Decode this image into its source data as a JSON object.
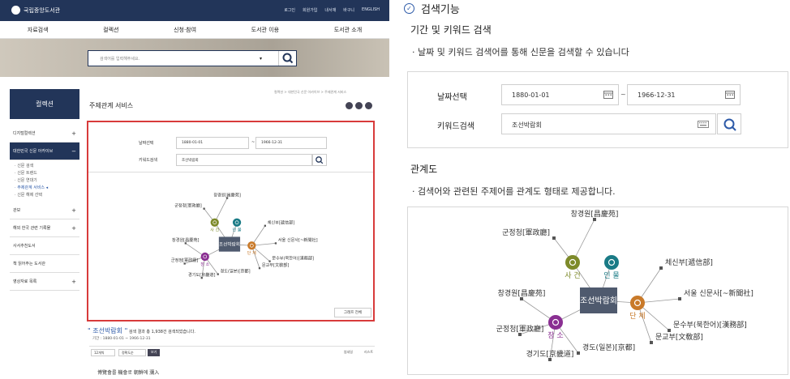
{
  "site": {
    "logo_text": "국립중앙도서관",
    "utils": [
      "로그인",
      "회원가입",
      "내서재",
      "바구니",
      "ENGLISH"
    ],
    "nav": [
      "자료검색",
      "컬렉션",
      "신청·참여",
      "도서관 이용",
      "도서관 소개"
    ],
    "search_placeholder": "검색어를 입력해주세요."
  },
  "sidebar": {
    "title": "컬렉션",
    "items": [
      "디지털컬렉션",
      "대한민국 신문 아카이브",
      "관보",
      "해외 한국 관련 기록물",
      "사서추천도서",
      "책 읽어주는 도서관",
      "영상자료 목록"
    ],
    "subitems": [
      "신문 검색",
      "신문 트렌드",
      "신문 연대기",
      "주제관계 서비스",
      "신문 해제 선택"
    ],
    "active_sub": "주제관계 서비스"
  },
  "content": {
    "title": "주제관계 서비스",
    "breadcrumb": "컬렉션 > 대한민국 신문 아카이브 > 주제관계 서비스",
    "date_label": "날짜선택",
    "date_from": "1880-01-01",
    "date_to": "1966-12-31",
    "keyword_label": "키워드검색",
    "keyword_value": "조선박람회",
    "graph_reset": "그래프 전체",
    "result_term": "\" 조선박람회 \"",
    "result_text": "검색 결과 총 1,938건 검색되었습니다.",
    "period_text": "기간 : 1880-01-01 ~ 1966-12-31",
    "per_page": "12개씩",
    "sort": "정확도순",
    "view_btn": "보기",
    "view_list": "썸네일",
    "view_thumb": "리스트",
    "article_title": "博覽會를 機會로 朝鮮에 瀰入"
  },
  "feature": {
    "title": "검색기능",
    "section1_title": "기간 및 키워드 검색",
    "section1_desc": "날짜 및 키워드 검색어를 통해 신문을 검색할 수 있습니다",
    "section2_title": "관계도",
    "section2_desc": "검색어와 관련된 주제어를 관계도 형태로 제공합니다."
  },
  "graph": {
    "center": "조선박람회",
    "categories": {
      "event": "사 건",
      "person": "인 물",
      "group": "단 체",
      "place": "장 소"
    },
    "event_nodes": [
      "창경원[昌慶苑]",
      "군정청[軍政廳]"
    ],
    "group_nodes": [
      "체신부[遞信部]",
      "서울 신문사[~新聞社]",
      "문수부(북한어)[漢務部]",
      "문교부[文敎部]"
    ],
    "place_nodes": [
      "창경원[昌慶苑]",
      "군정청[軍政廳]",
      "경기도[京畿道]",
      "경도(일본)[京都]"
    ]
  },
  "colors": {
    "navy": "#223559",
    "red": "#d83b3b",
    "event": "#7d8a2a",
    "person": "#1a7b86",
    "group": "#c97a2a",
    "place": "#8a2f92",
    "center": "#4f5a6e"
  }
}
